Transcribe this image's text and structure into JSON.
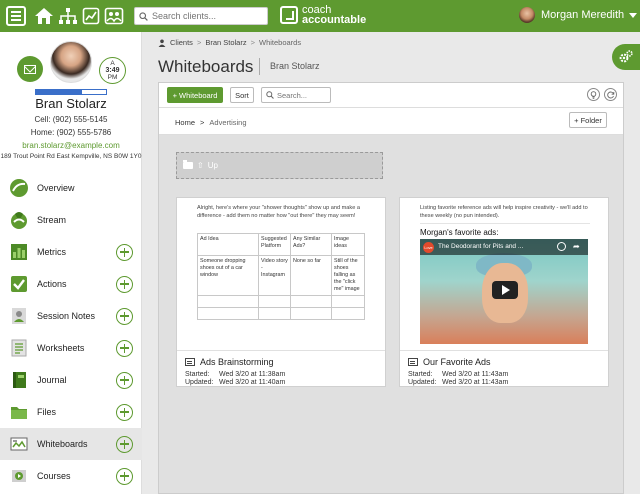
{
  "topbar": {
    "search_placeholder": "Search clients...",
    "logo_line1": "coach",
    "logo_line2": "accountable",
    "user_name": "Morgan Meredith",
    "icons": [
      "menu-icon",
      "home-icon",
      "org-chart-icon",
      "chart-icon",
      "group-icon"
    ]
  },
  "profile": {
    "time_top": "A",
    "time": "3:49",
    "time_period": "PM",
    "name": "Bran Stolarz",
    "cell": "Cell:  (902) 555-5145",
    "home": "Home:  (902) 555-5786",
    "email": "bran.stolarz@example.com",
    "address": "189 Trout Point Rd East Kempville, NS B0W 1Y0",
    "progress": 0.65
  },
  "nav": [
    {
      "label": "Overview",
      "icon": "overview-icon",
      "plus": false
    },
    {
      "label": "Stream",
      "icon": "stream-icon",
      "plus": false
    },
    {
      "label": "Metrics",
      "icon": "metrics-icon",
      "plus": true
    },
    {
      "label": "Actions",
      "icon": "actions-icon",
      "plus": true
    },
    {
      "label": "Session Notes",
      "icon": "session-notes-icon",
      "plus": true
    },
    {
      "label": "Worksheets",
      "icon": "worksheets-icon",
      "plus": true
    },
    {
      "label": "Journal",
      "icon": "journal-icon",
      "plus": true
    },
    {
      "label": "Files",
      "icon": "files-icon",
      "plus": true
    },
    {
      "label": "Whiteboards",
      "icon": "whiteboards-icon",
      "plus": true,
      "active": true
    },
    {
      "label": "Courses",
      "icon": "courses-icon",
      "plus": true
    }
  ],
  "breadcrumb": {
    "root": "Clients",
    "client": "Bran Stolarz",
    "page": "Whiteboards"
  },
  "page": {
    "title": "Whiteboards",
    "subtitle": "Bran Stolarz"
  },
  "toolbar": {
    "add_label": "+ Whiteboard",
    "sort_label": "Sort",
    "search_placeholder": "Search..."
  },
  "folder_nav": {
    "home": "Home",
    "current": "Advertising",
    "add_folder_label": "+ Folder",
    "up_label": "Up"
  },
  "cards": [
    {
      "intro": "Alright, here's where your \"shower thoughts\" show up and make a difference - add them no matter how \"out there\" they may seem!",
      "table": {
        "headers": [
          "Ad Idea",
          "Suggested Platform",
          "Any Similar Ads?",
          "Image ideas"
        ],
        "rows": [
          [
            "Someone dropping shoes out of a car window",
            "Video story - Instagram",
            "None so far",
            "Still of the shoes falling as the \"click me\" image"
          ],
          [
            "",
            "",
            "",
            ""
          ],
          [
            "",
            "",
            "",
            ""
          ]
        ]
      },
      "title": "Ads Brainstorming",
      "started_label": "Started:",
      "started": "Wed 3/20 at 11:38am",
      "updated_label": "Updated:",
      "updated": "Wed 3/20 at 11:40am"
    },
    {
      "intro": "Listing favorite reference ads will help inspire creativity - we'll add to these weekly (no pun intended).",
      "heading": "Morgan's favorite ads:",
      "video_title": "The Deodorant for Pits and ...",
      "video_logo": "Love",
      "title": "Our Favorite Ads",
      "started_label": "Started:",
      "started": "Wed 3/20 at 11:43am",
      "updated_label": "Updated:",
      "updated": "Wed 3/20 at 11:43am"
    }
  ],
  "colors": {
    "brand": "#5e9a30",
    "progress": "#3a6fc9"
  }
}
